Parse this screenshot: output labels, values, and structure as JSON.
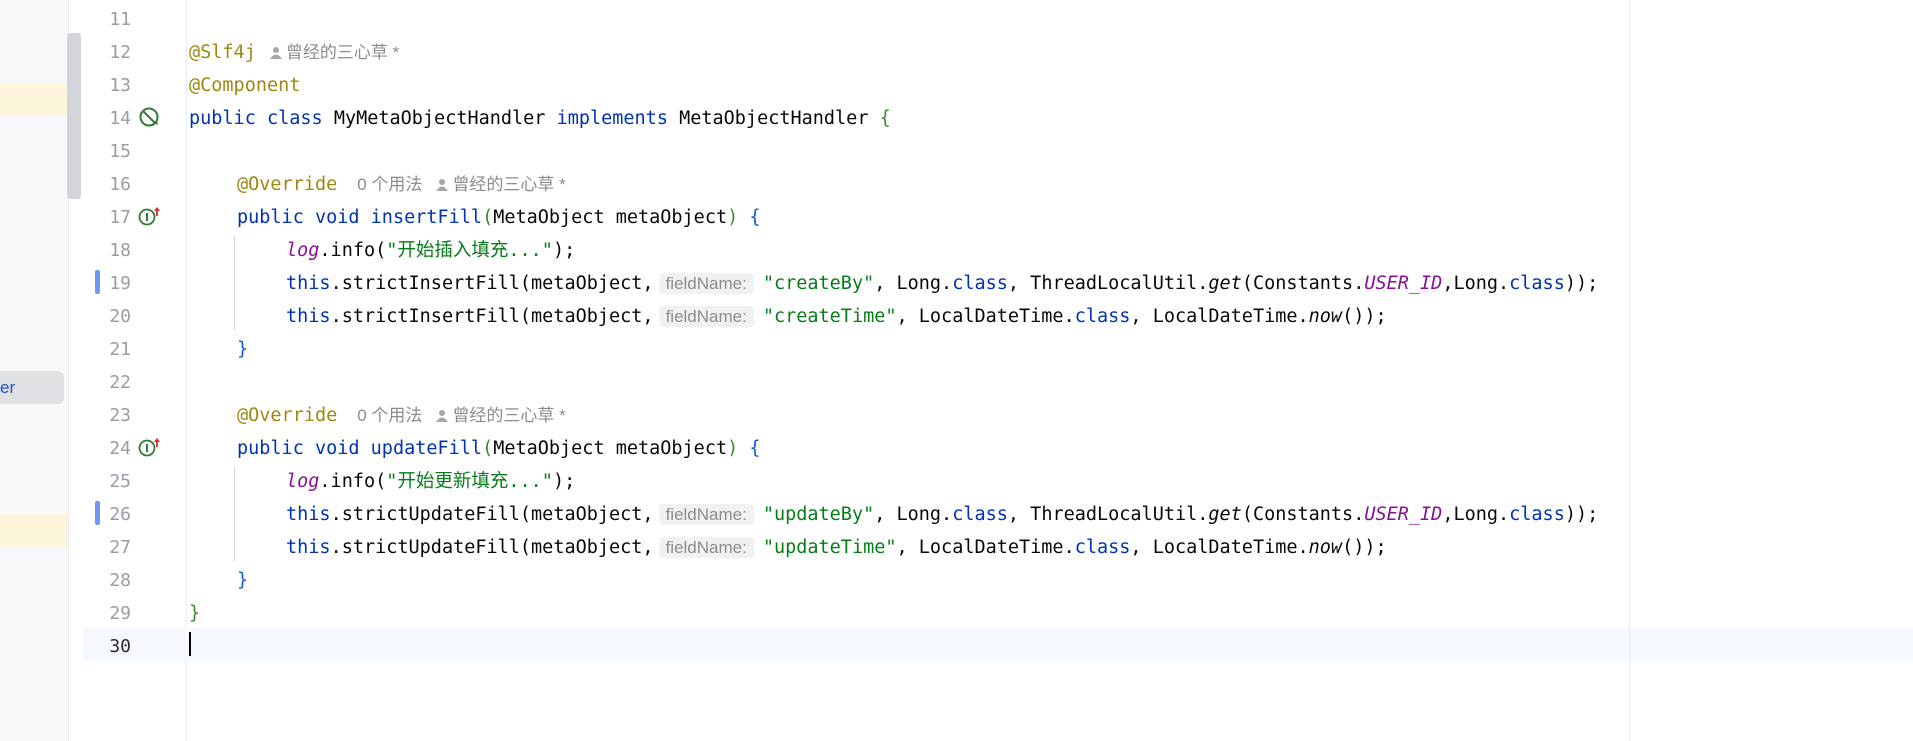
{
  "left_panel": {
    "selected_fragment": "er"
  },
  "gutter": {
    "lines": [
      "11",
      "12",
      "13",
      "14",
      "15",
      "16",
      "17",
      "18",
      "19",
      "20",
      "21",
      "22",
      "23",
      "24",
      "25",
      "26",
      "27",
      "28",
      "29",
      "30"
    ],
    "icons": {
      "line14": "no-bean-icon",
      "line17": "implements-method-icon",
      "line24": "implements-method-icon"
    }
  },
  "code": {
    "l12": {
      "annotation": "@Slf4j",
      "author": "曾经的三心草 *"
    },
    "l13": {
      "annotation": "@Component"
    },
    "l14": {
      "kw1": "public",
      "kw2": "class",
      "name": "MyMetaObjectHandler",
      "kw3": "implements",
      "iface": "MetaObjectHandler",
      "brace": "{"
    },
    "l16": {
      "annotation": "@Override",
      "usages": "0 个用法",
      "author": "曾经的三心草 *"
    },
    "l17": {
      "kw1": "public",
      "kw2": "void",
      "method": "insertFill",
      "open": "(",
      "params": "MetaObject metaObject",
      "close": ")",
      "brace": "{"
    },
    "l18": {
      "log": "log",
      "call": ".info(",
      "str": "\"开始插入填充...\"",
      "end": ");"
    },
    "l19": {
      "this": "this",
      "call": ".strictInsertFill(metaObject,",
      "hint": "fieldName:",
      "str": "\"createBy\"",
      "p1": ", Long.",
      "cls1": "class",
      "p2": ", ThreadLocalUtil.",
      "get": "get",
      "p3": "(Constants.",
      "field": "USER_ID",
      "p4": ",Long.",
      "cls2": "class",
      "end": "));"
    },
    "l20": {
      "this": "this",
      "call": ".strictInsertFill(metaObject,",
      "hint": "fieldName:",
      "str": "\"createTime\"",
      "p1": ", LocalDateTime.",
      "cls1": "class",
      "p2": ", LocalDateTime.",
      "now": "now",
      "end": "());"
    },
    "l21": {
      "brace": "}"
    },
    "l23": {
      "annotation": "@Override",
      "usages": "0 个用法",
      "author": "曾经的三心草 *"
    },
    "l24": {
      "kw1": "public",
      "kw2": "void",
      "method": "updateFill",
      "open": "(",
      "params": "MetaObject metaObject",
      "close": ")",
      "brace": "{"
    },
    "l25": {
      "log": "log",
      "call": ".info(",
      "str": "\"开始更新填充...\"",
      "end": ");"
    },
    "l26": {
      "this": "this",
      "call": ".strictUpdateFill(metaObject,",
      "hint": "fieldName:",
      "str": "\"updateBy\"",
      "p1": ", Long.",
      "cls1": "class",
      "p2": ", ThreadLocalUtil.",
      "get": "get",
      "p3": "(Constants.",
      "field": "USER_ID",
      "p4": ",Long.",
      "cls2": "class",
      "end": "));"
    },
    "l27": {
      "this": "this",
      "call": ".strictUpdateFill(metaObject,",
      "hint": "fieldName:",
      "str": "\"updateTime\"",
      "p1": ", LocalDateTime.",
      "cls1": "class",
      "p2": ", LocalDateTime.",
      "now": "now",
      "end": "());"
    },
    "l28": {
      "brace": "}"
    },
    "l29": {
      "brace": "}"
    }
  },
  "colors": {
    "keyword": "#0033b3",
    "annotation": "#9e880d",
    "string": "#067d17",
    "static_field": "#871094",
    "current_line": "#f5f8fe",
    "change_marker": "#6f97f5"
  }
}
